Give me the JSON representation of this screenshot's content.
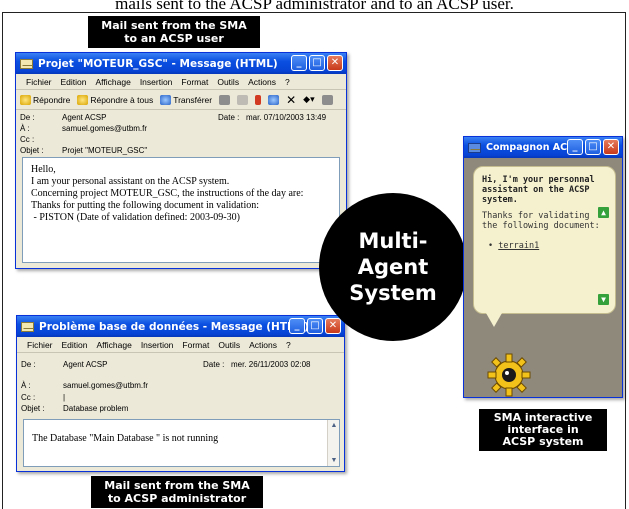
{
  "top_text": "mails sent to the ACSP administrator and to an ACSP user.",
  "captions": {
    "user_mail": [
      "Mail sent from the SMA",
      "to an ACSP user"
    ],
    "admin_mail": [
      "Mail sent from the SMA",
      "to ACSP administrator"
    ],
    "sma_interface": [
      "SMA interactive",
      "interface in",
      "ACSP system"
    ]
  },
  "center_label": [
    "Multi-",
    "Agent",
    "System"
  ],
  "window_user": {
    "title": "Projet \"MOTEUR_GSC\" - Message (HTML)",
    "menu": [
      "Fichier",
      "Edition",
      "Affichage",
      "Insertion",
      "Format",
      "Outils",
      "Actions",
      "?"
    ],
    "toolbar": [
      "Répondre",
      "Répondre à tous",
      "Transférer"
    ],
    "from_label": "De :",
    "from": "Agent ACSP",
    "date_label": "Date :",
    "date": "mar. 07/10/2003 13:49",
    "to_label": "À :",
    "to": "samuel.gomes@utbm.fr",
    "cc_label": "Cc :",
    "cc": "",
    "subject_label": "Objet :",
    "subject": "Projet \"MOTEUR_GSC\"",
    "body": [
      "Hello,",
      "I am your personal assistant on the ACSP system.",
      "Concerning project MOTEUR_GSC, the instructions of the day are:",
      "Thanks for putting the following document in validation:",
      " - PISTON (Date of validation defined: 2003-09-30)"
    ]
  },
  "window_admin": {
    "title": "Problème base de données - Message (HTML)",
    "menu": [
      "Fichier",
      "Edition",
      "Affichage",
      "Insertion",
      "Format",
      "Outils",
      "Actions",
      "?"
    ],
    "from_label": "De :",
    "from": "Agent ACSP",
    "date_label": "Date :",
    "date": "mer. 26/11/2003 02:08",
    "to_label": "À :",
    "to": "samuel.gomes@utbm.fr",
    "cc_label": "Cc :",
    "cc": "|",
    "subject_label": "Objet :",
    "subject": "Database problem",
    "body": "The Database \"Main Database \" is not running"
  },
  "companion": {
    "title": "Compagnon AC...",
    "greeting": [
      "Hi, I'm your personnal",
      "assistant on the ACSP",
      "system."
    ],
    "message": [
      "Thanks for validating",
      "the following document:"
    ],
    "item": "terrain1"
  }
}
